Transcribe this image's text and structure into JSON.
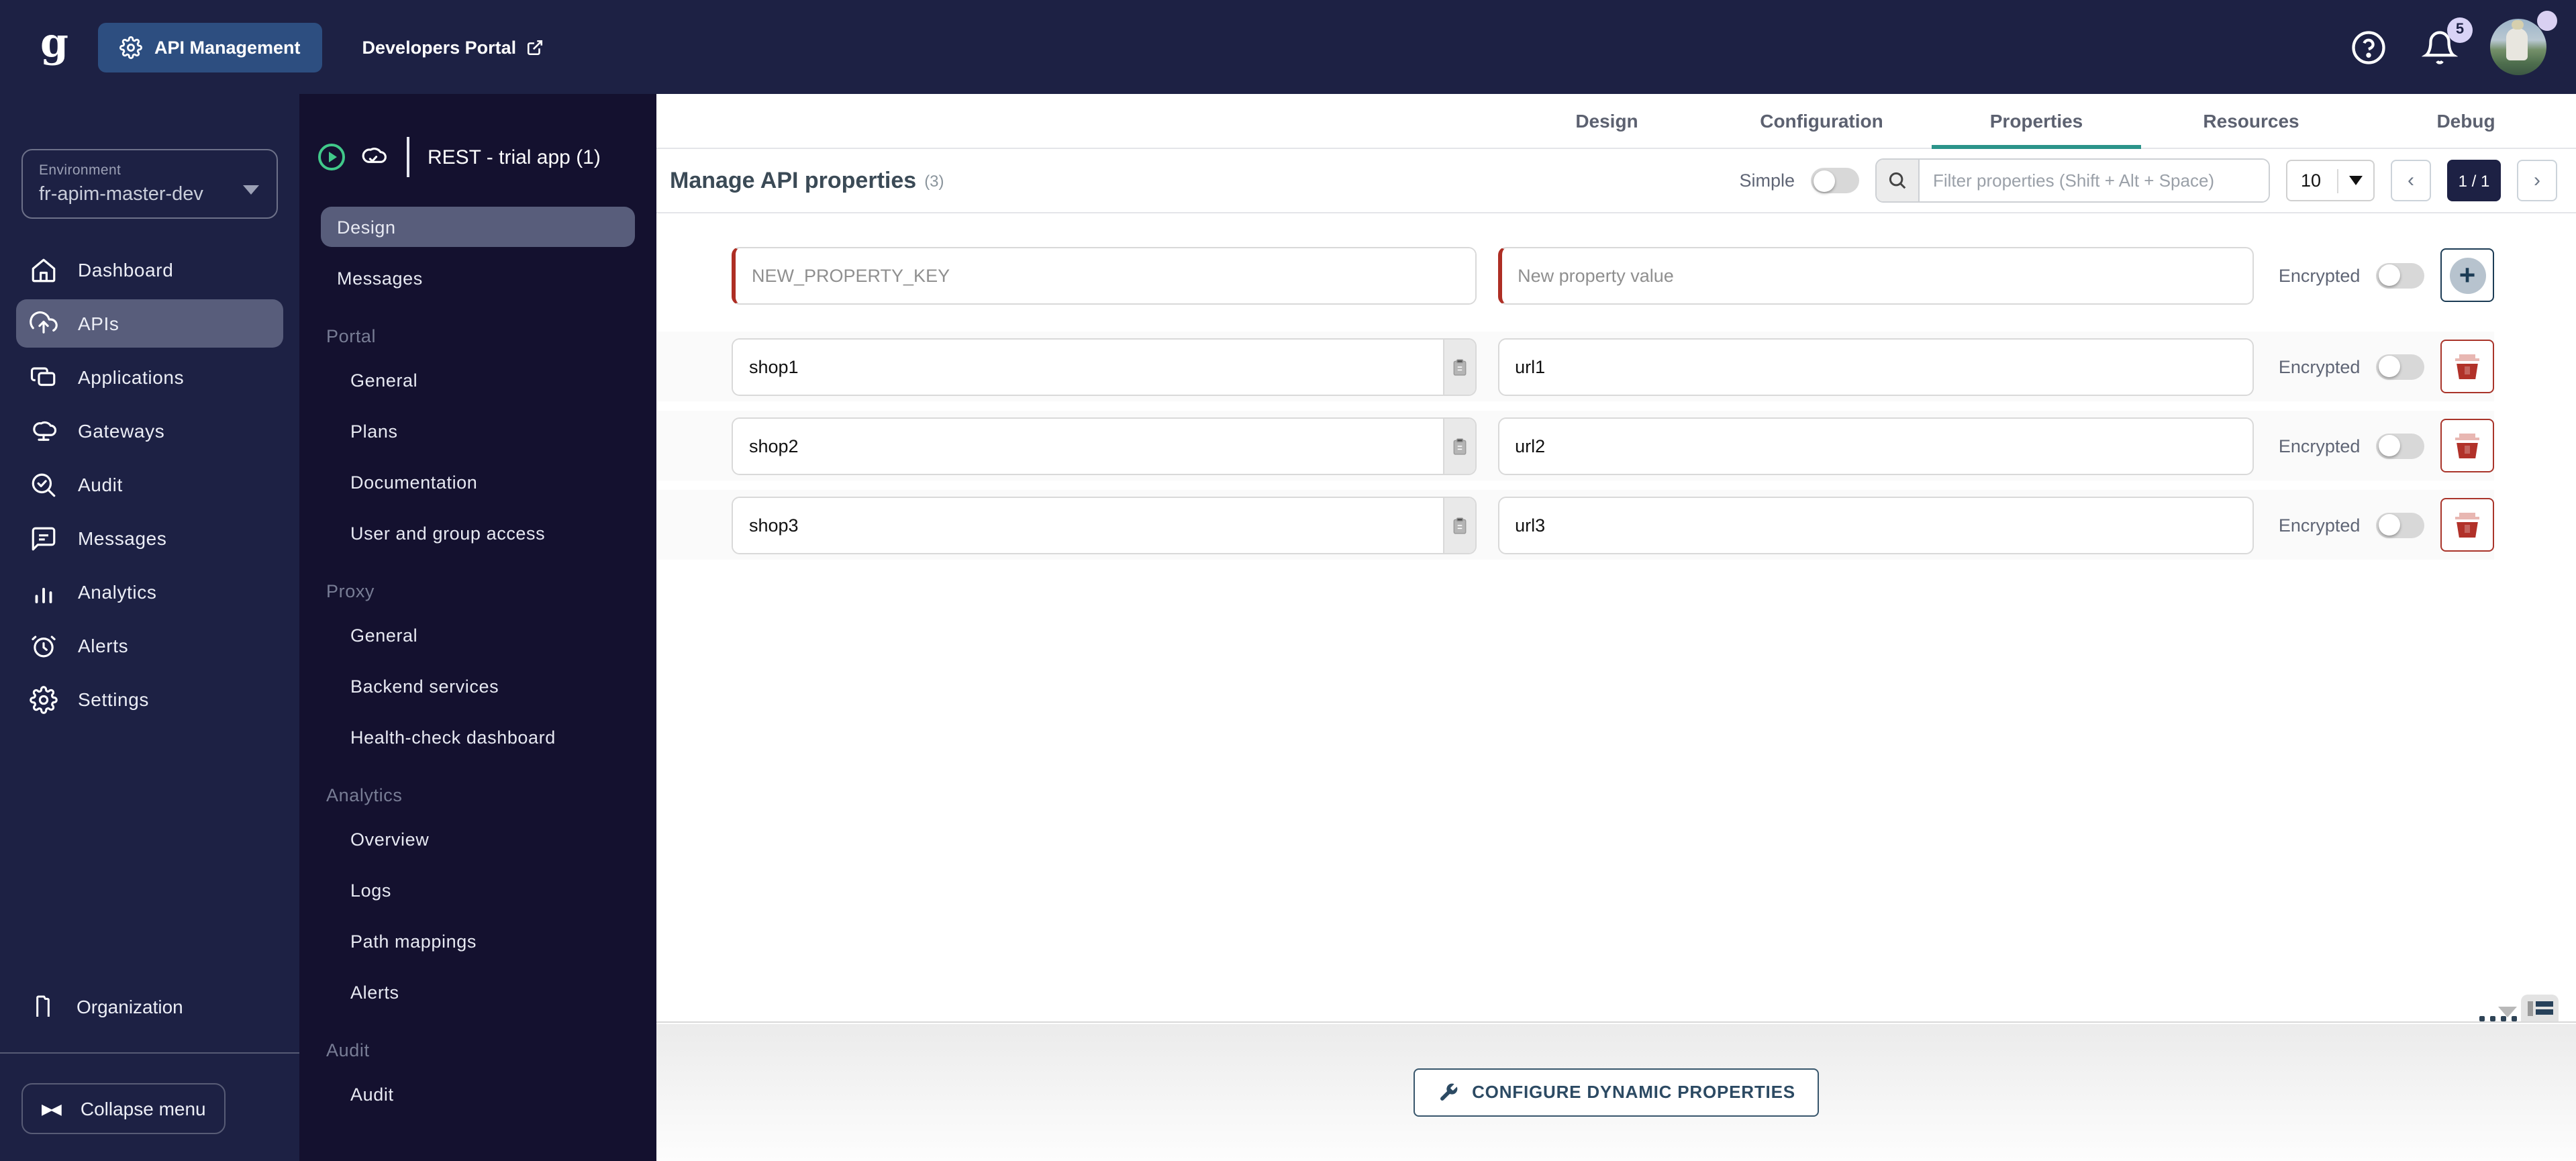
{
  "topbar": {
    "logo": "g",
    "app_button": "API Management",
    "portal_link": "Developers Portal",
    "notifications_count": "5"
  },
  "sidebar": {
    "environment_label": "Environment",
    "environment_value": "fr-apim-master-dev",
    "items": [
      {
        "label": "Dashboard",
        "icon": "home-icon",
        "active": false
      },
      {
        "label": "APIs",
        "icon": "cloud-upload-icon",
        "active": true
      },
      {
        "label": "Applications",
        "icon": "copy-stack-icon",
        "active": false
      },
      {
        "label": "Gateways",
        "icon": "cloud-icon",
        "active": false
      },
      {
        "label": "Audit",
        "icon": "search-check-icon",
        "active": false
      },
      {
        "label": "Messages",
        "icon": "message-icon",
        "active": false
      },
      {
        "label": "Analytics",
        "icon": "bar-chart-icon",
        "active": false
      },
      {
        "label": "Alerts",
        "icon": "alarm-icon",
        "active": false
      },
      {
        "label": "Settings",
        "icon": "gear-icon",
        "active": false
      }
    ],
    "organization": "Organization",
    "collapse": "Collapse menu"
  },
  "api_menu": {
    "title": "REST - trial app (1)",
    "top_items": [
      "Design",
      "Messages"
    ],
    "active": "Design",
    "sections": [
      {
        "header": "Portal",
        "items": [
          "General",
          "Plans",
          "Documentation",
          "User and group access"
        ]
      },
      {
        "header": "Proxy",
        "items": [
          "General",
          "Backend services",
          "Health-check dashboard"
        ]
      },
      {
        "header": "Analytics",
        "items": [
          "Overview",
          "Logs",
          "Path mappings",
          "Alerts"
        ]
      },
      {
        "header": "Audit",
        "items": [
          "Audit"
        ]
      }
    ]
  },
  "tabs": {
    "items": [
      "Design",
      "Configuration",
      "Properties",
      "Resources",
      "Debug"
    ],
    "active": "Properties"
  },
  "properties": {
    "heading": "Manage API properties",
    "count": "(3)",
    "simple_label": "Simple",
    "filter_placeholder": "Filter properties (Shift + Alt + Space)",
    "page_size": "10",
    "page_indicator": "1 / 1",
    "prev_glyph": "‹",
    "next_glyph": "›",
    "new_key_placeholder": "NEW_PROPERTY_KEY",
    "new_value_placeholder": "New property value",
    "encrypted_label": "Encrypted",
    "add_glyph": "+",
    "rows": [
      {
        "key": "shop1",
        "value": "url1"
      },
      {
        "key": "shop2",
        "value": "url2"
      },
      {
        "key": "shop3",
        "value": "url3"
      }
    ]
  },
  "footer": {
    "configure_button": "CONFIGURE DYNAMIC PROPERTIES"
  },
  "colors": {
    "topbar_navy": "#1d2144",
    "secondary_navy": "#14112f",
    "active_item": "#585d7b",
    "accent_teal": "#2b948a",
    "danger_red": "#ae2e24",
    "button_slate": "#2c4a63",
    "badge_lavender": "#d9d3f6"
  }
}
